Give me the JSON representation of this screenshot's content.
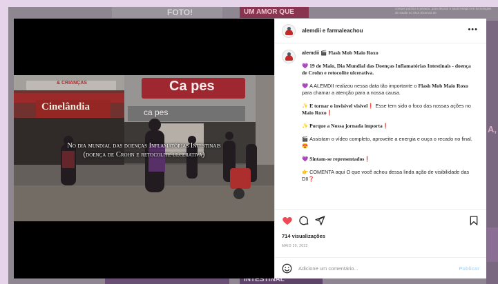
{
  "background": {
    "top_left_banner": "FOTO!",
    "top_right_banner": "UM AMOR QUE",
    "right_text": "compre publico e privado. para discutir o atual estagio em tecnologias de saude no SUS (Doenca de",
    "right_letters": "A,",
    "bottom_banner": "INTESTINAL"
  },
  "post": {
    "header_user": "alemdii e farmaleachou",
    "more_icon": "more-options-icon",
    "video_caption_line1": "No dia mundial das doenças Inflamatórias Intestinais",
    "video_caption_line2": "(doença de Crohn e retocolite ulcerativa)",
    "storefronts": {
      "left_sign": "Cinelândia",
      "left_top_sign": "& CRIANÇAS",
      "right_sign": "Ca pes",
      "right_sign_lower": "ca pes"
    },
    "caption": {
      "username": "alemdii",
      "title": "Flash Mob Maio Roxo",
      "p1_bold": "19 de Maio, Dia Mundial das Doenças Inflamatórias Intestinais - doença de Crohn e retocolite ulcerativa.",
      "p2_start": "A ALEMDII realizou nessa data tão importante o ",
      "p2_bold": "Flash Mob Maio Roxo",
      "p2_end": " para chamar a atenção para a nossa causa.",
      "p3_bold": "E tornar o invisível visível",
      "p3_mid": " Esse tem sido o foco das nossas ações no ",
      "p3_bold2": "Maio Roxo",
      "p4_bold": "Porque a Nossa jornada importa",
      "p5": "Assistam o vídeo completo, aproveite a energia e ouça o recado no final.",
      "p6_bold": "Sintam-se representados",
      "p7": "COMENTA aqui O que você achou dessa linda ação de visibilidade das DII"
    },
    "views": "714 visualizações",
    "date": "MAIO 20, 2022",
    "comment_placeholder": "Adicione um comentário...",
    "publish_label": "Publicar",
    "colors": {
      "like": "#ed4956",
      "purple": "#8e44ad",
      "publish": "#b2dffc"
    }
  }
}
